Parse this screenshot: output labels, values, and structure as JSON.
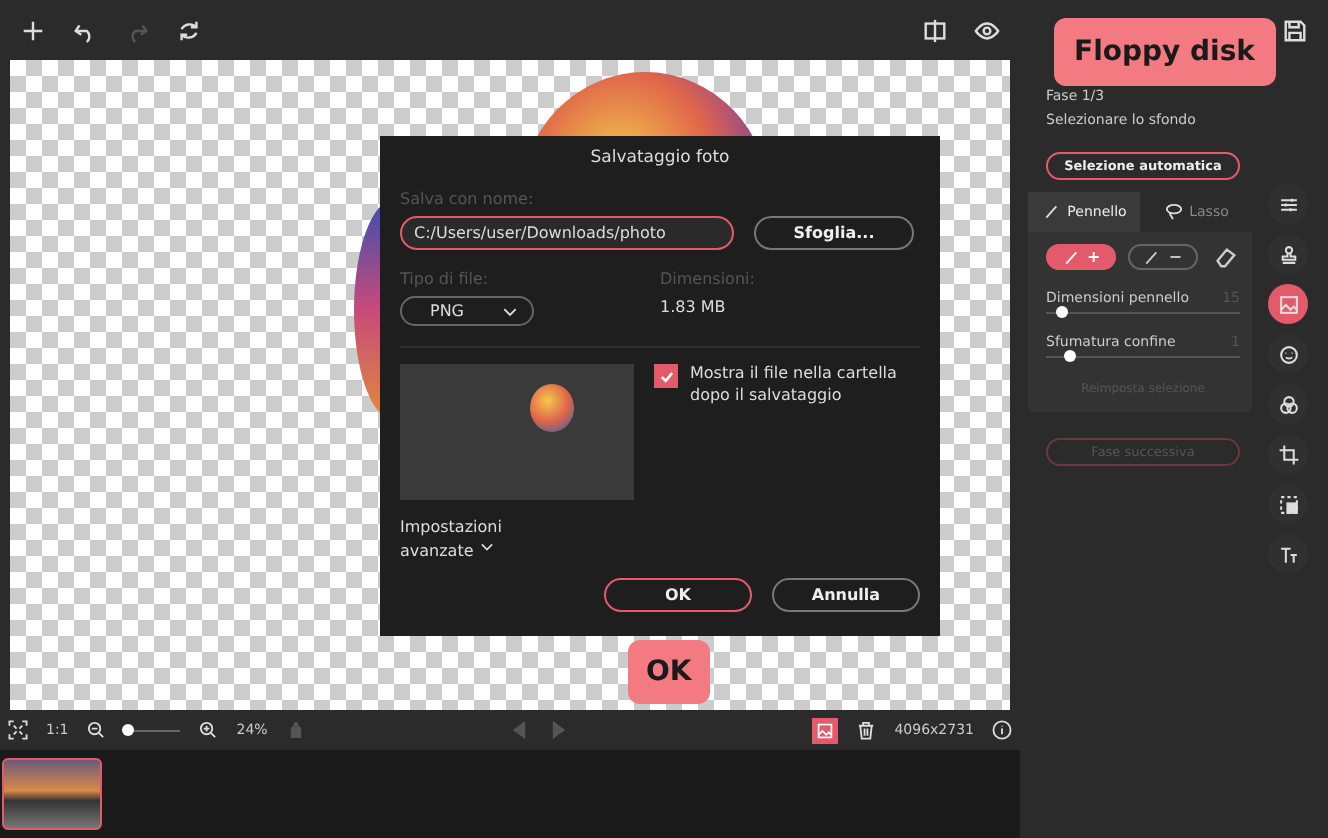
{
  "panel": {
    "step": "Fase 1/3",
    "instruction": "Selezionare lo sfondo",
    "auto_button": "Selezione automatica",
    "tabs": [
      {
        "label": "Pennello",
        "selected": true
      },
      {
        "label": "Lasso",
        "selected": false
      }
    ],
    "modes": [
      {
        "kind": "add",
        "label": "+",
        "selected": true
      },
      {
        "kind": "remove",
        "label": "−",
        "selected": false
      },
      {
        "kind": "eraser",
        "selected": false
      }
    ],
    "sliders": [
      {
        "label": "Dimensioni pennello",
        "value": "15",
        "level": 0.08
      },
      {
        "label": "Sfumatura confine",
        "value": "1",
        "level": 0.12
      }
    ],
    "reset_button": {
      "label": "Reimposta selezione",
      "disabled": true
    },
    "next_button": {
      "label": "Fase successiva",
      "disabled": true
    }
  },
  "rail": [
    {
      "selected": false
    },
    {
      "selected": false
    },
    {
      "selected": true
    },
    {
      "selected": false
    },
    {
      "selected": false
    },
    {
      "selected": false
    },
    {
      "selected": false
    },
    {
      "selected": false
    }
  ],
  "dialog": {
    "title": "Salvataggio foto",
    "name_label": "Salva con nome:",
    "path": "C:/Users/user/Downloads/photo",
    "browse_button": "Sfoglia...",
    "type_label": "Tipo di file:",
    "type_value": "PNG",
    "size_label": "Dimensioni:",
    "size_value": "1.83 MB",
    "show_in_folder": {
      "label": "Mostra il file nella cartella dopo il salvataggio",
      "checked": true
    },
    "advanced": "Impostazioni avanzate",
    "ok_button": "OK",
    "cancel_button": "Annulla"
  },
  "bottom_bar": {
    "fit_ratio": "1:1",
    "zoom": {
      "level": 0.05,
      "reading": "24%"
    },
    "dimensions": "4096x2731"
  },
  "filmstrip": [
    {
      "selected": true
    }
  ],
  "callouts": [
    {
      "text": "Floppy disk"
    },
    {
      "text": "OK"
    }
  ]
}
